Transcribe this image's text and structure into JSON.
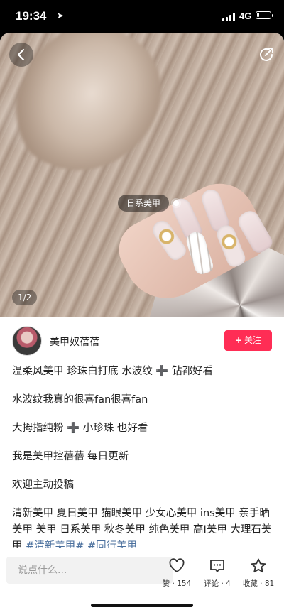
{
  "status": {
    "time": "19:34",
    "network": "4G",
    "signal_bars": 4,
    "battery_level": 0.2
  },
  "photo": {
    "tag_label": "日系美甲",
    "counter": "1/2"
  },
  "author": {
    "name": "美甲奴蓓蓓",
    "follow_label": "关注"
  },
  "content": {
    "paragraphs": [
      "温柔风美甲 珍珠白打底 水波纹 ➕ 钻都好看",
      "水波纹我真的很喜fan很喜fan",
      "大拇指纯粉 ➕ 小珍珠 也好看",
      "我是美甲控蓓蓓 每日更新",
      "欢迎主动投稿"
    ],
    "tags_text": "清新美甲 夏日美甲 猫眼美甲 少女心美甲 ins美甲 亲手晒美甲 美甲 日系美甲 秋冬美甲 纯色美甲 高Ⅰ美甲 大理石美甲",
    "hashtag_text": " #清新美甲# #同行美甲"
  },
  "bottom_bar": {
    "comment_placeholder": "说点什么...",
    "like_label": "赞 · 154",
    "comment_label": "评论 · 4",
    "collect_label": "收藏 · 81"
  }
}
